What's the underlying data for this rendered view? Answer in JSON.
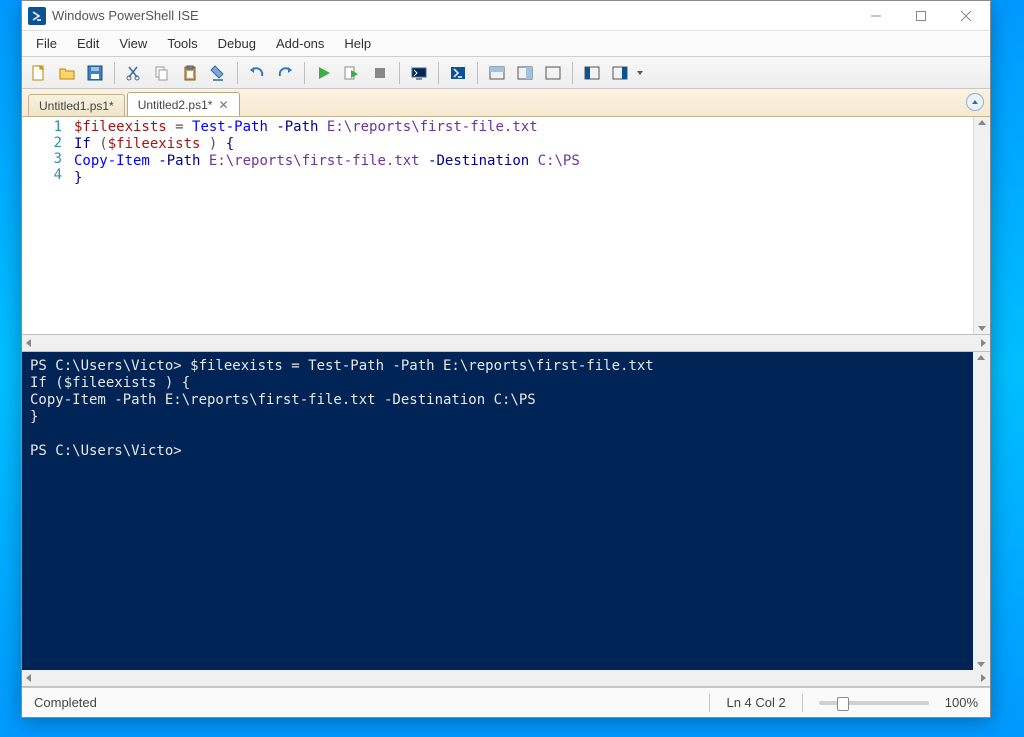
{
  "titlebar": {
    "title": "Windows PowerShell ISE",
    "icon_glyph": "▷_"
  },
  "menu": {
    "items": [
      "File",
      "Edit",
      "View",
      "Tools",
      "Debug",
      "Add-ons",
      "Help"
    ]
  },
  "toolbar": {
    "icons": [
      "new-file-icon",
      "open-file-icon",
      "save-icon",
      "cut-icon",
      "copy-icon",
      "paste-icon",
      "clear-icon",
      "undo-icon",
      "redo-icon",
      "run-icon",
      "run-selection-icon",
      "stop-icon",
      "new-remote-icon",
      "start-powershell-icon",
      "layout-top-icon",
      "layout-right-icon",
      "layout-full-icon",
      "show-command-icon",
      "show-addon-icon"
    ]
  },
  "tabs": [
    {
      "label": "Untitled1.ps1*",
      "active": false
    },
    {
      "label": "Untitled2.ps1*",
      "active": true
    }
  ],
  "editor": {
    "lines": [
      {
        "n": "1",
        "tokens": [
          {
            "t": "$fileexists",
            "c": "tok-var"
          },
          {
            "t": " = ",
            "c": "tok-op"
          },
          {
            "t": "Test-Path",
            "c": "tok-cmd"
          },
          {
            "t": " ",
            "c": ""
          },
          {
            "t": "-Path",
            "c": "tok-param"
          },
          {
            "t": " ",
            "c": ""
          },
          {
            "t": "E:\\reports\\first-file.txt",
            "c": "tok-val"
          }
        ]
      },
      {
        "n": "2",
        "tokens": [
          {
            "t": "If",
            "c": "tok-kw"
          },
          {
            "t": " (",
            "c": "tok-op"
          },
          {
            "t": "$fileexists",
            "c": "tok-var"
          },
          {
            "t": " ) ",
            "c": "tok-op"
          },
          {
            "t": "{",
            "c": "tok-brace"
          }
        ]
      },
      {
        "n": "3",
        "tokens": [
          {
            "t": "Copy-Item",
            "c": "tok-cmd"
          },
          {
            "t": " ",
            "c": ""
          },
          {
            "t": "-Path",
            "c": "tok-param"
          },
          {
            "t": " ",
            "c": ""
          },
          {
            "t": "E:\\reports\\first-file.txt",
            "c": "tok-val"
          },
          {
            "t": " ",
            "c": ""
          },
          {
            "t": "-Destination",
            "c": "tok-param"
          },
          {
            "t": " ",
            "c": ""
          },
          {
            "t": "C:\\PS",
            "c": "tok-val"
          }
        ]
      },
      {
        "n": "4",
        "tokens": [
          {
            "t": "}",
            "c": "tok-brace"
          }
        ]
      }
    ]
  },
  "console": {
    "text": "PS C:\\Users\\Victo> $fileexists = Test-Path -Path E:\\reports\\first-file.txt\nIf ($fileexists ) {\nCopy-Item -Path E:\\reports\\first-file.txt -Destination C:\\PS\n}\n\nPS C:\\Users\\Victo>"
  },
  "status": {
    "left": "Completed",
    "pos": "Ln 4  Col 2",
    "zoom": "100%"
  }
}
